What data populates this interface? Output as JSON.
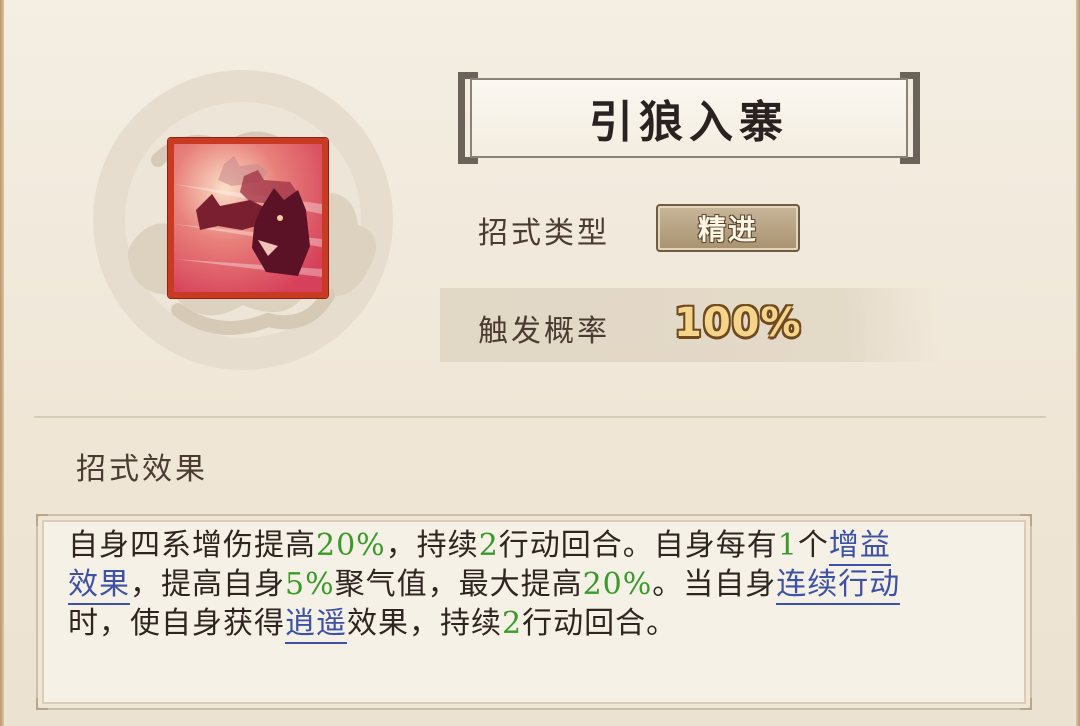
{
  "skill": {
    "name": "引狼入寨",
    "type_label": "招式类型",
    "type_value": "精进",
    "probability_label": "触发概率",
    "probability_value": "100%",
    "effect_title": "招式效果",
    "icon": "wolf-pack-icon"
  },
  "description": {
    "line1": [
      {
        "t": "自身四系增伤提高"
      },
      {
        "t": "20%",
        "style": "num"
      },
      {
        "t": "，持续"
      },
      {
        "t": "2",
        "style": "num"
      },
      {
        "t": "行动回合。自身每有"
      },
      {
        "t": "1",
        "style": "num"
      },
      {
        "t": "个"
      },
      {
        "t": "增益",
        "style": "link"
      }
    ],
    "line2": [
      {
        "t": "效果",
        "style": "link"
      },
      {
        "t": "，提高自身"
      },
      {
        "t": "5%",
        "style": "num"
      },
      {
        "t": "聚气值，最大提高"
      },
      {
        "t": "20%",
        "style": "num"
      },
      {
        "t": "。当自身"
      },
      {
        "t": "连续行动",
        "style": "link"
      }
    ],
    "line3": [
      {
        "t": "时，使自身获得"
      },
      {
        "t": "逍遥",
        "style": "link"
      },
      {
        "t": "效果，持续"
      },
      {
        "t": "2",
        "style": "num"
      },
      {
        "t": "行动回合。"
      }
    ]
  },
  "colors": {
    "number_green": "#3a9a2a",
    "link_blue": "#3d52a6",
    "icon_frame_red": "#c93a22"
  }
}
